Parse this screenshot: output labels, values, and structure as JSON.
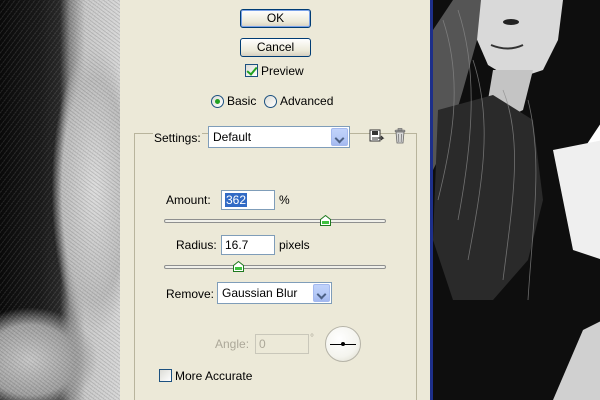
{
  "dialog": {
    "ok_label": "OK",
    "cancel_label": "Cancel",
    "preview_label": "Preview",
    "preview_checked": true,
    "mode": {
      "basic_label": "Basic",
      "advanced_label": "Advanced",
      "selected": "Basic"
    },
    "settings": {
      "label": "Settings:",
      "value": "Default"
    },
    "amount": {
      "label": "Amount:",
      "value": "362",
      "unit": "%",
      "slider_fraction": 0.724
    },
    "radius": {
      "label": "Radius:",
      "value": "16.7",
      "unit": "pixels",
      "slider_fraction": 0.334
    },
    "remove": {
      "label": "Remove:",
      "value": "Gaussian Blur"
    },
    "angle": {
      "label": "Angle:",
      "value": "0",
      "unit": "°"
    },
    "more_accurate_label": "More Accurate",
    "more_accurate_checked": false
  },
  "icons": {
    "save_settings": "save-settings-icon",
    "delete_settings": "trash-icon"
  },
  "colors": {
    "dialog_bg": "#ece9d8",
    "accent_check": "#21a121",
    "selection": "#316ac5",
    "preview_border": "#1d2f8a"
  }
}
